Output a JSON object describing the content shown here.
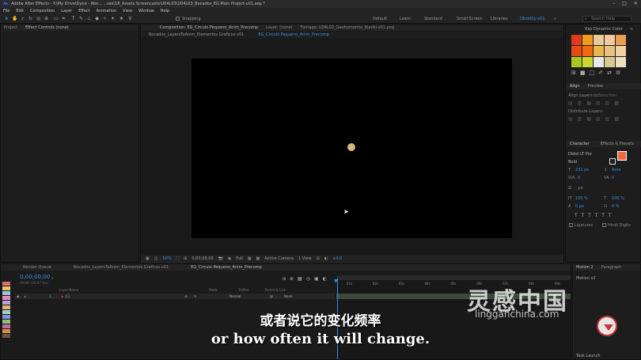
{
  "titlebar": {
    "title": "Adobe After Effects - Y:\\My Drive\\Dyne - Wor... ...ses\\18_Assets Screencasts\\U04L03\\U04L03_Bocados_EG Main Project-v01.aep *"
  },
  "menu": [
    "File",
    "Edit",
    "Composition",
    "Layer",
    "Effect",
    "Animation",
    "View",
    "Window",
    "Help"
  ],
  "toolbar": {
    "snapping": "Snapping",
    "workspaces": [
      "Default",
      "Learn",
      "Standard",
      "Small Screen",
      "Libraries"
    ],
    "active_workspace": "Obsidity-v01",
    "search_placeholder": "Search Help"
  },
  "left_panel": {
    "tabs": [
      "Project",
      "Effect Controls (none)"
    ]
  },
  "composition": {
    "tabs": [
      "Composition: EG_Circulo Pequeno_Anim_Precomp",
      "Layer: (none)",
      "Footage: U04L02_Geohomomia_Bianki-v01.png"
    ],
    "subtabs": [
      "Bocados_LayersToAnim_Elementos Graficos-v01",
      "EG_Circulo Pequeno_Anim_Precomp"
    ],
    "zoom": "50%",
    "timecode": "0;00;00;00",
    "quality": "Full",
    "camera": "Active Camera",
    "view": "1 View",
    "exposure": "+0.0"
  },
  "right_panel": {
    "color_title": "Kay Dynamic Color",
    "swatches": [
      "#e33a1e",
      "#f09a1f",
      "#e8c99a",
      "#f3c7a2",
      "#e8a050",
      "#e84a14",
      "#f06a10",
      "#e8b84e",
      "#e8c280",
      "#f0d0a0",
      "#a8c820",
      "#c8d830",
      "#e8e8e8",
      "#d8c890",
      "#ece0c0"
    ],
    "align_tabs": [
      "Align",
      "Preview"
    ],
    "align_layers_to": "Align Layers to:",
    "align_target": "Selection",
    "distribute": "Distribute Layers:",
    "char_tabs": [
      "Character",
      "Effects & Presets"
    ],
    "font": "Didot LT Pro",
    "style": "Bold",
    "size": "231 px",
    "leading": "Auto",
    "kerning": "0",
    "tracking": "0",
    "stroke": "- px",
    "vscale": "100 %",
    "hscale": "100 %",
    "baseline": "0 px",
    "tsume": "0 %",
    "ligatures": "Ligatures",
    "hindi": "Hindi Digits",
    "colors": {
      "fill": "#f06a40",
      "stroke": "#ffffff"
    }
  },
  "timeline": {
    "tabs": [
      "Render Queue",
      "Bocados_LayersToAnim_Elementos Graficos-v01",
      "EG_Circulo Pequeno_Anim_Precomp"
    ],
    "timecode": "0;00;00;00",
    "fps": "00000 (29.97 fps)",
    "columns": [
      "Layer Name",
      "Mode",
      "TrkMat",
      "Parent & Link"
    ],
    "layer": {
      "index": "1",
      "name": "C1",
      "mode": "Normal",
      "parent": "None"
    },
    "ruler": [
      "01s",
      "02s",
      "03s",
      "04s",
      "05s",
      "06s",
      "07s",
      "08s",
      "09s"
    ]
  },
  "side_panel": {
    "tabs": [
      "Motion 2",
      "Paragraph"
    ],
    "motion_label": "Motion v2",
    "task": "Task Launch"
  },
  "subtitle": {
    "zh": "或者说它的变化频率",
    "en": "or how often it will change."
  },
  "watermark": {
    "cn": "灵感中国",
    "url": "lingganchina.com"
  }
}
